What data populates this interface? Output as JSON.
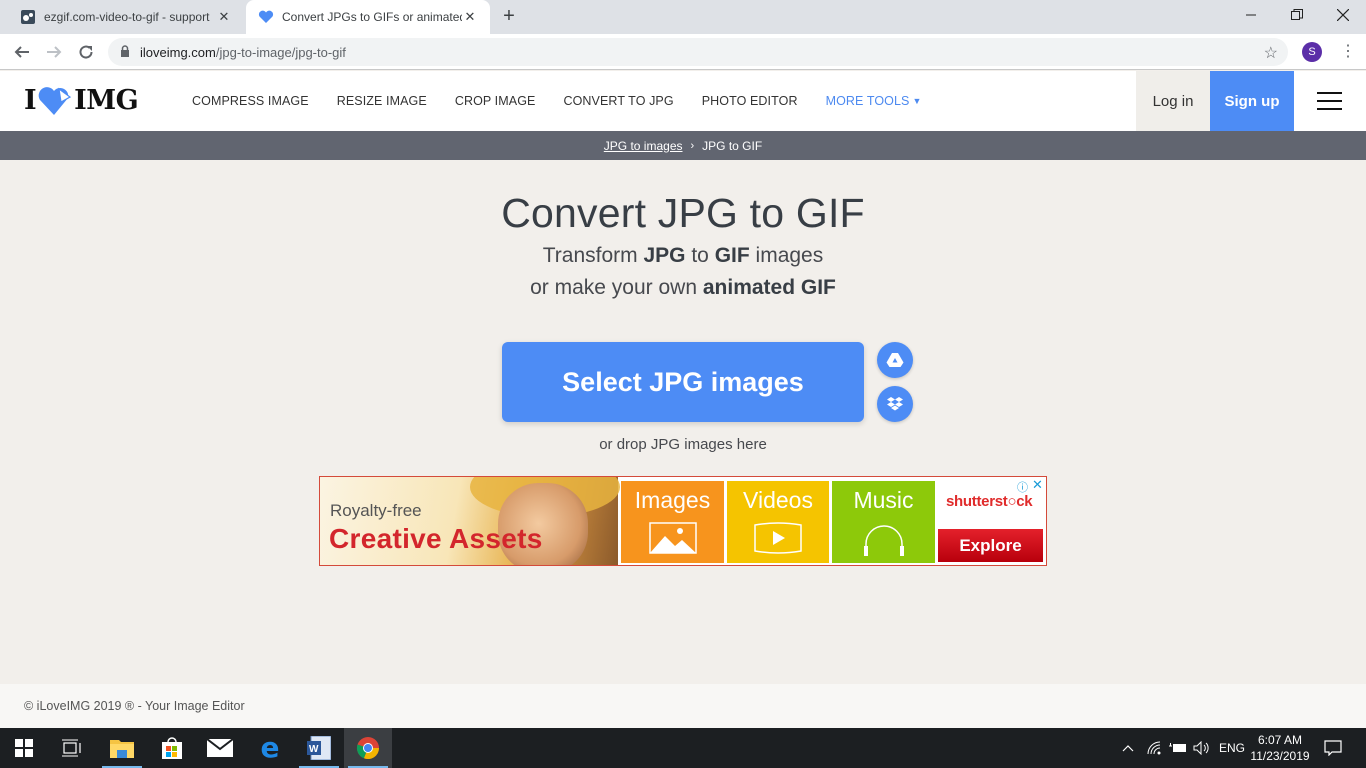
{
  "browser": {
    "tabs": [
      {
        "title": "ezgif.com-video-to-gif - support",
        "icon": "ezgif-favicon",
        "active": false
      },
      {
        "title": "Convert JPGs to GIFs or animated",
        "icon": "iloveimg-heart-favicon",
        "active": true
      }
    ],
    "new_tab_label": "+",
    "url_host": "iloveimg.com",
    "url_path": "/jpg-to-image/jpg-to-gif",
    "profile_initial": "S",
    "profile_color": "#5b2ea8"
  },
  "site": {
    "logo": {
      "left": "I",
      "right": "IMG"
    },
    "nav": [
      "COMPRESS IMAGE",
      "RESIZE IMAGE",
      "CROP IMAGE",
      "CONVERT TO JPG",
      "PHOTO EDITOR"
    ],
    "more_tools": "MORE TOOLS",
    "login": "Log in",
    "signup": "Sign up",
    "accent_color": "#4d8cf5"
  },
  "breadcrumb": {
    "parent": "JPG to images",
    "separator": "›",
    "current": "JPG to GIF"
  },
  "hero": {
    "title": "Convert JPG to GIF",
    "line1": {
      "a": "Transform ",
      "b1": "JPG",
      "c": " to ",
      "b2": "GIF",
      "d": " images"
    },
    "line2": {
      "a": "or make your own ",
      "b": "animated GIF"
    },
    "select_button": "Select JPG images",
    "drop_hint": "or drop JPG images here",
    "cloud_buttons": [
      "google-drive",
      "dropbox"
    ]
  },
  "ad": {
    "eyebrow": "Royalty-free",
    "headline": "Creative Assets",
    "tiles": [
      "Images",
      "Videos",
      "Music"
    ],
    "brand_a": "shutterst",
    "brand_b": "ck",
    "cta": "Explore",
    "info": "ⓘ",
    "close": "✕"
  },
  "footer": {
    "text": "© iLoveIMG 2019 ® - Your Image Editor"
  },
  "taskbar": {
    "apps": [
      "start",
      "task-view",
      "file-explorer",
      "microsoft-store",
      "mail",
      "edge",
      "word",
      "chrome"
    ],
    "language": "ENG",
    "time": "6:07 AM",
    "date": "11/23/2019"
  }
}
